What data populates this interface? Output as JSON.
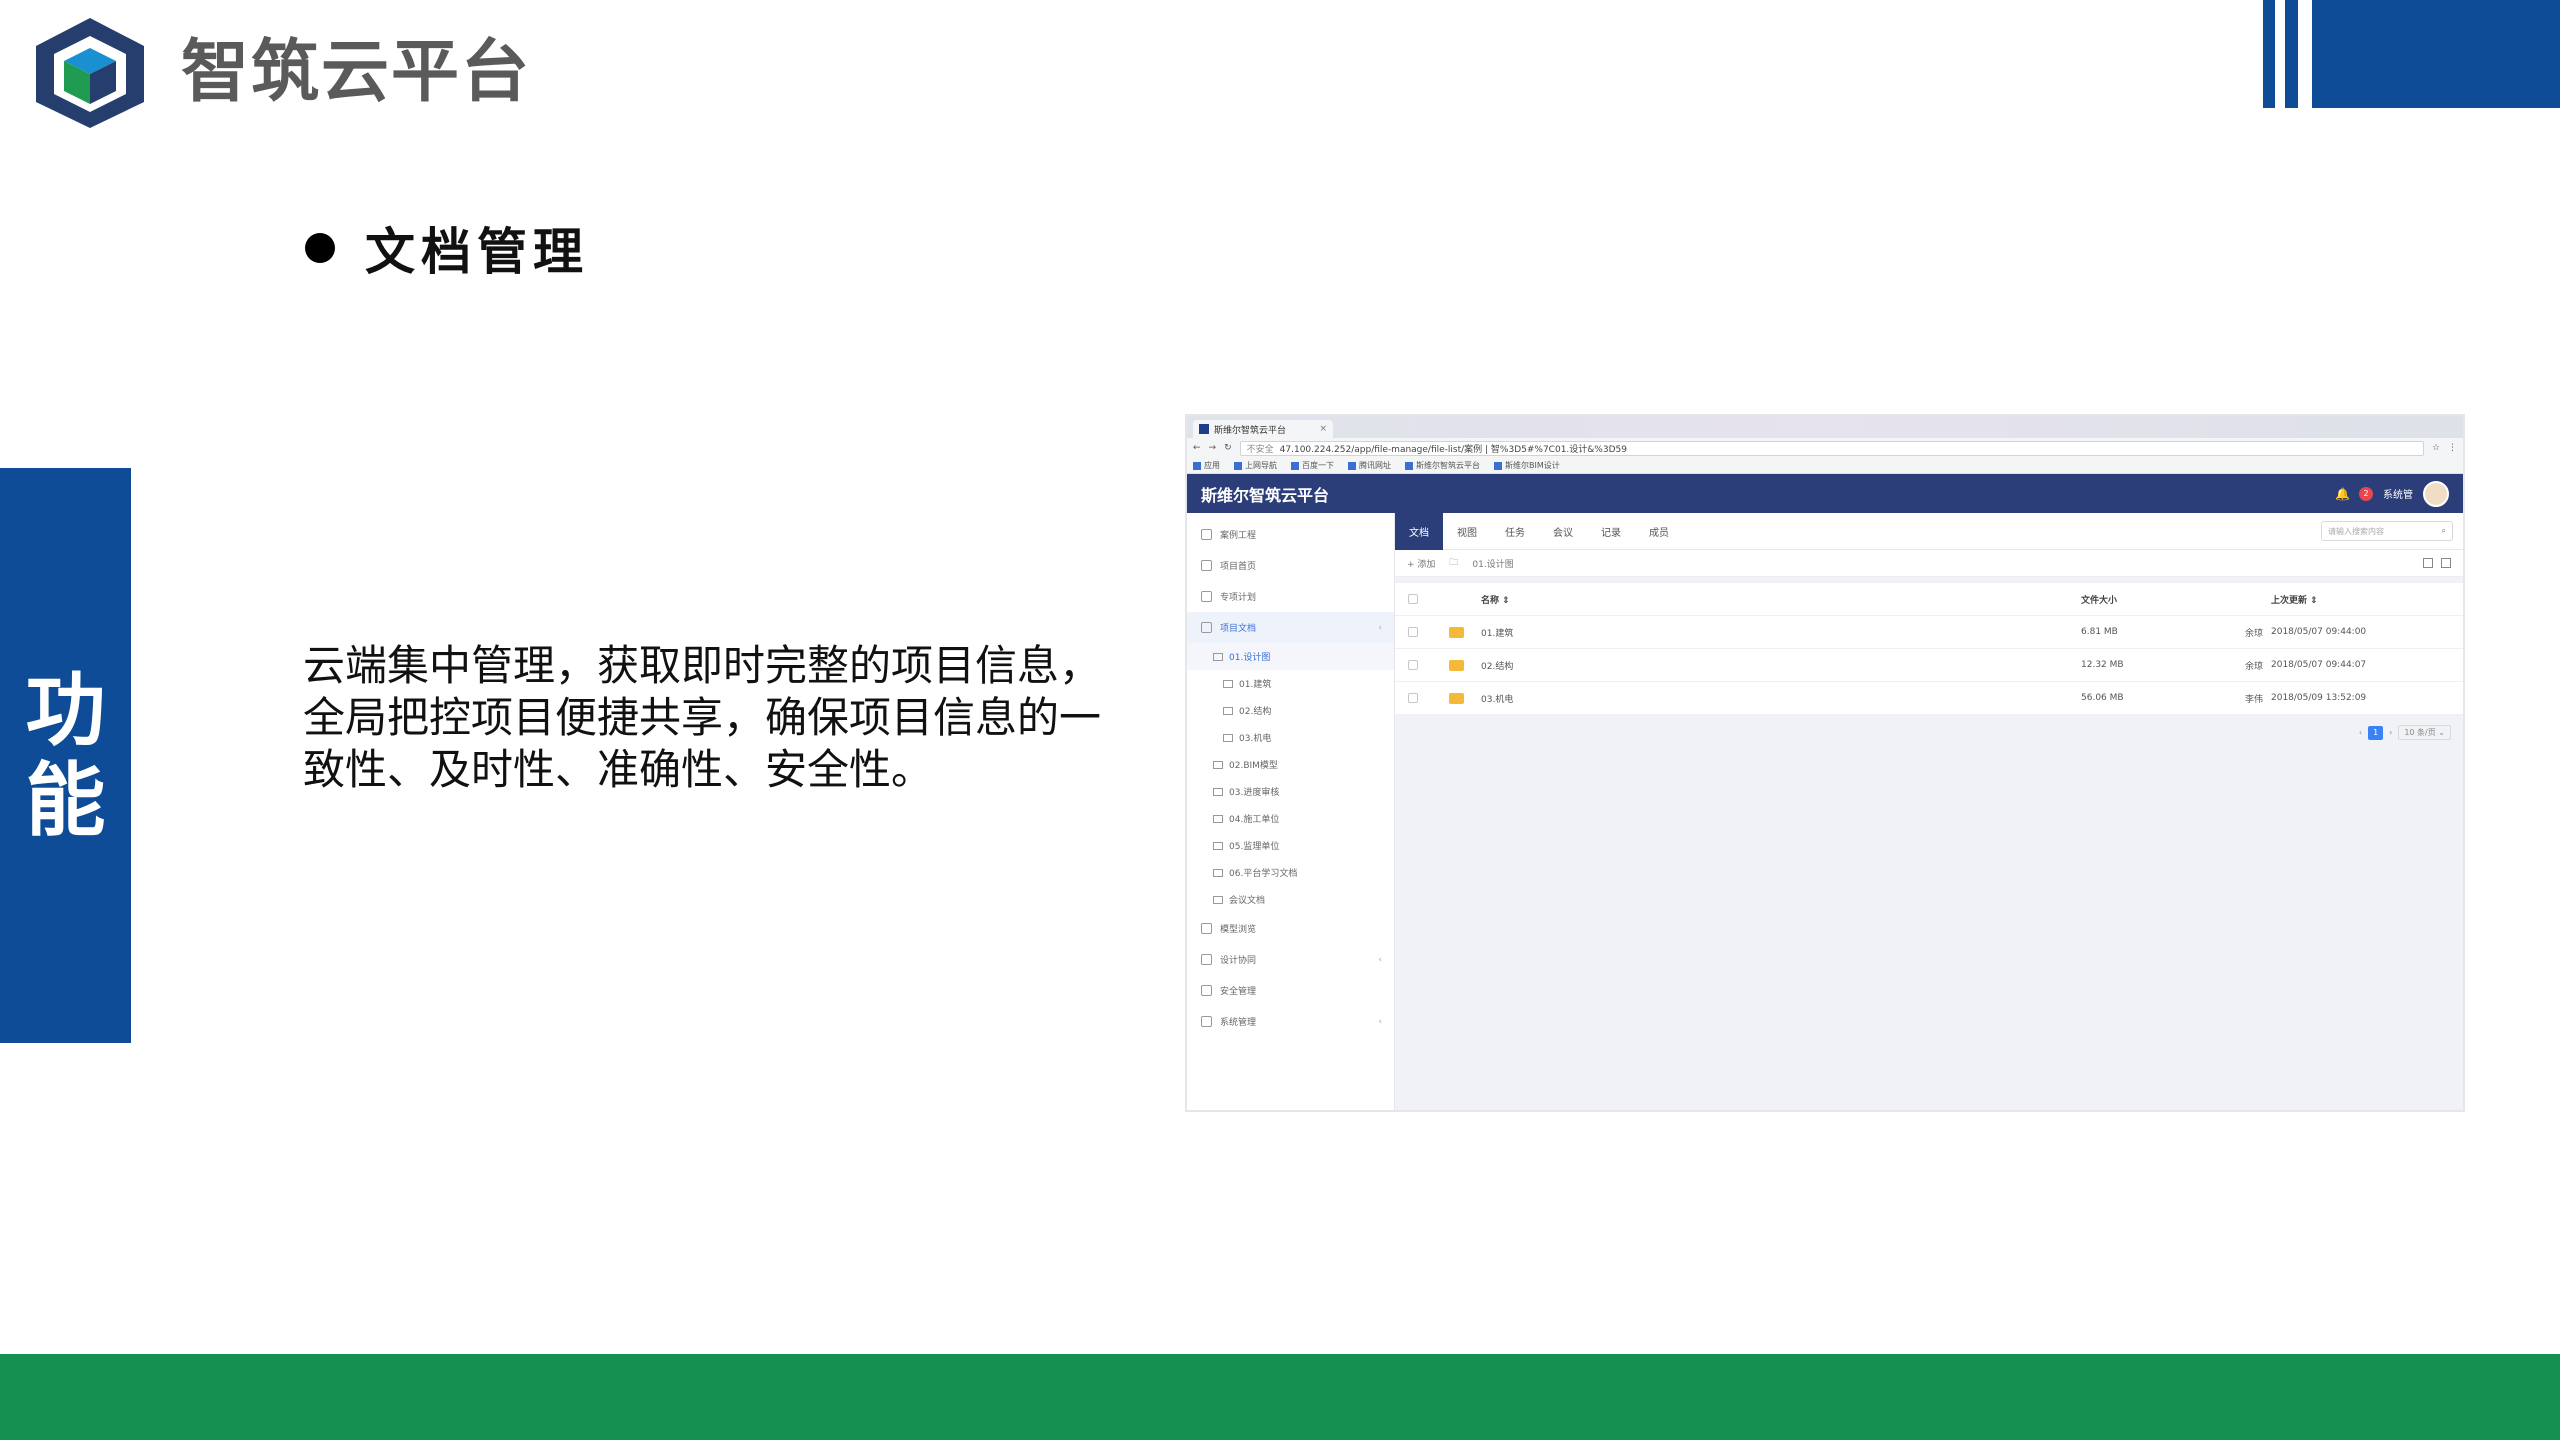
{
  "logo": {
    "text": "智筑云平台"
  },
  "side_panel": {
    "label": "功能"
  },
  "section": {
    "title": "文档管理"
  },
  "description": "云端集中管理，获取即时完整的项目信息，全局把控项目便捷共享，确保项目信息的一致性、及时性、准确性、安全性。",
  "screenshot": {
    "browser": {
      "tab_title": "斯维尔智筑云平台",
      "tab_close": "×",
      "insecure_label": "不安全",
      "url": "47.100.224.252/app/file-manage/file-list/案例 | 智%3D5#%7C01.设计&%3D59",
      "bookmarks": [
        "应用",
        "上网导航",
        "百度一下",
        "腾讯网址",
        "斯维尔智筑云平台",
        "斯维尔BIM设计"
      ]
    },
    "app": {
      "title": "斯维尔智筑云平台",
      "notification_count": "2",
      "user_name": "系统管",
      "sidebar": [
        {
          "label": "案例工程",
          "active": false,
          "chevron": ""
        },
        {
          "label": "项目首页",
          "active": false,
          "chevron": ""
        },
        {
          "label": "专项计划",
          "active": false,
          "chevron": ""
        },
        {
          "label": "项目文档",
          "active": true,
          "chevron": "‹"
        }
      ],
      "sidebar_sub_active": "01.设计图",
      "sidebar_sub_nested": [
        "01.建筑",
        "02.结构",
        "03.机电"
      ],
      "sidebar_sub_folders": [
        "02.BIM模型",
        "03.进度审核",
        "04.施工单位",
        "05.监理单位",
        "06.平台学习文档",
        "会议文档"
      ],
      "sidebar_bottom": [
        {
          "label": "模型浏览",
          "chevron": ""
        },
        {
          "label": "设计协同",
          "chevron": "‹"
        },
        {
          "label": "安全管理",
          "chevron": ""
        },
        {
          "label": "系统管理",
          "chevron": "‹"
        }
      ],
      "tabs": [
        "文档",
        "视图",
        "任务",
        "会议",
        "记录",
        "成员"
      ],
      "search_placeholder": "请输入搜索内容",
      "toolbar": {
        "add_label": "+ 添加",
        "breadcrumb": "01.设计图"
      },
      "table": {
        "headers": {
          "name": "名称 ⇕",
          "size": "文件大小",
          "date": "上次更新 ⇕"
        },
        "rows": [
          {
            "name": "01.建筑",
            "size": "6.81 MB",
            "user": "余琼",
            "date": "2018/05/07 09:44:00"
          },
          {
            "name": "02.结构",
            "size": "12.32 MB",
            "user": "余琼",
            "date": "2018/05/07 09:44:07"
          },
          {
            "name": "03.机电",
            "size": "56.06 MB",
            "user": "李伟",
            "date": "2018/05/09 13:52:09"
          }
        ]
      },
      "pager": {
        "current": "1",
        "page_size": "10 条/页 ⌄"
      }
    }
  },
  "colors": {
    "brand_blue": "#0e4c97",
    "band_green": "#169050",
    "app_header": "#2c3e7a"
  }
}
